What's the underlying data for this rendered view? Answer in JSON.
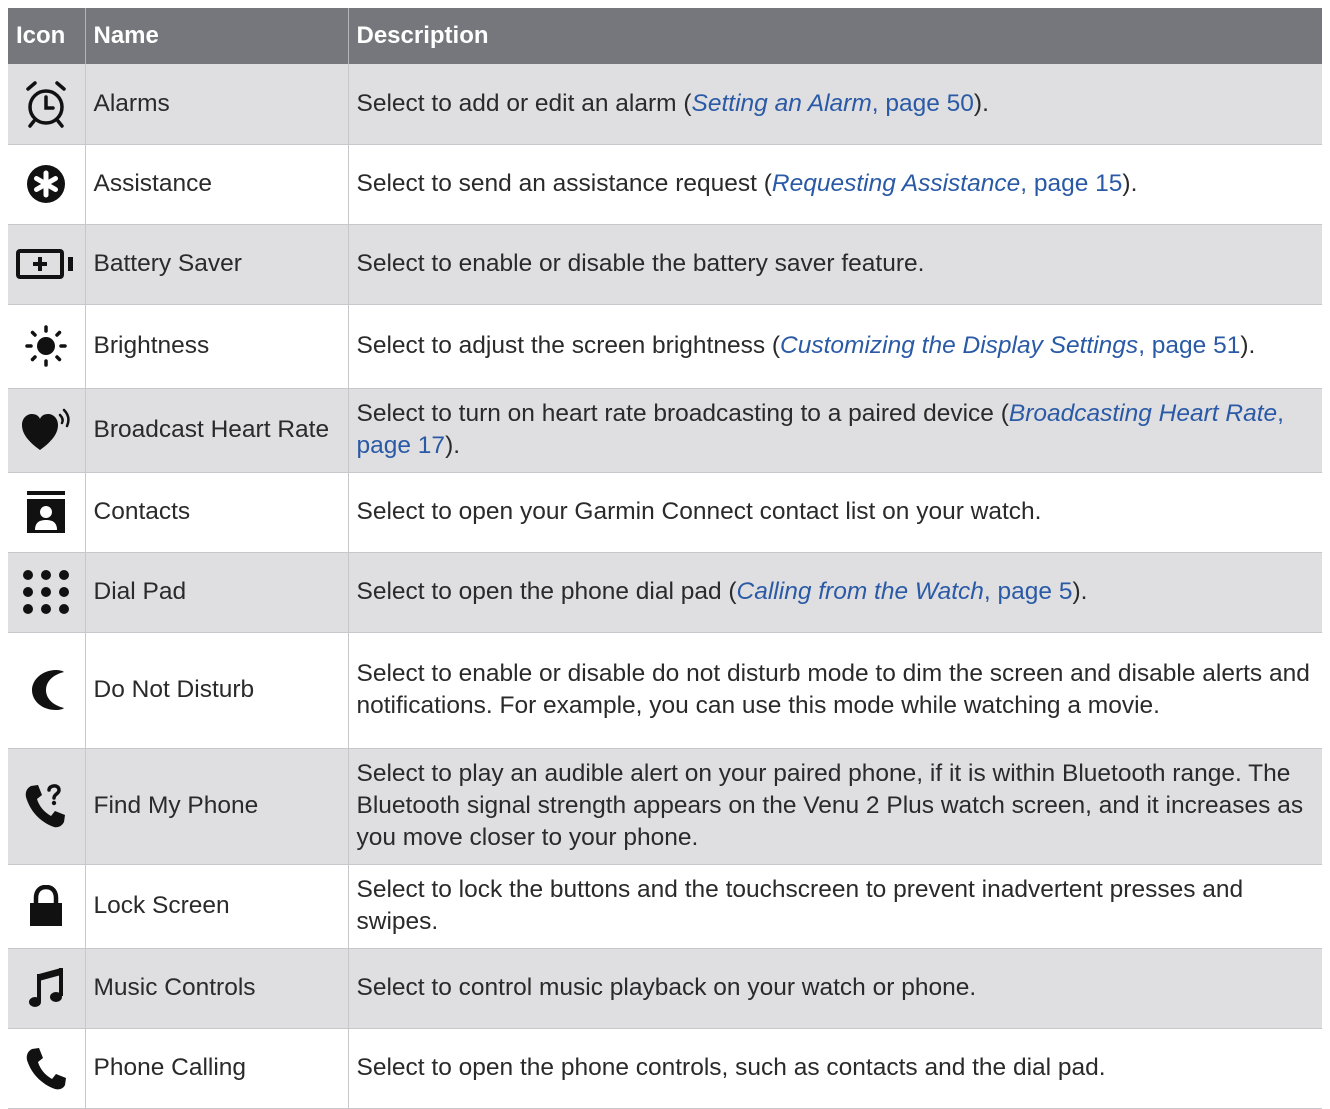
{
  "header": {
    "icon": "Icon",
    "name": "Name",
    "description": "Description"
  },
  "rows": [
    {
      "icon": "alarm-clock-icon",
      "name": "Alarms",
      "desc_pre": "Select to add or edit an alarm (",
      "link_title": "Setting an Alarm",
      "link_page": ", page 50",
      "desc_post": ")."
    },
    {
      "icon": "assistance-icon",
      "name": "Assistance",
      "desc_pre": "Select to send an assistance request (",
      "link_title": "Requesting Assistance",
      "link_page": ", page 15",
      "desc_post": ")."
    },
    {
      "icon": "battery-saver-icon",
      "name": "Battery Saver",
      "desc_pre": "Select to enable or disable the battery saver feature.",
      "link_title": "",
      "link_page": "",
      "desc_post": ""
    },
    {
      "icon": "brightness-icon",
      "name": "Brightness",
      "desc_pre": "Select to adjust the screen brightness (",
      "link_title": "Customizing the Display Settings",
      "link_page": ", page 51",
      "desc_post": ")."
    },
    {
      "icon": "broadcast-heart-icon",
      "name": "Broadcast Heart Rate",
      "desc_pre": "Select to turn on heart rate broadcasting to a paired device (",
      "link_title": "Broadcasting Heart Rate",
      "link_page": ", page 17",
      "desc_post": ")."
    },
    {
      "icon": "contacts-icon",
      "name": "Contacts",
      "desc_pre": "Select to open your Garmin Connect contact list on your watch.",
      "link_title": "",
      "link_page": "",
      "desc_post": ""
    },
    {
      "icon": "dial-pad-icon",
      "name": "Dial Pad",
      "desc_pre": "Select to open the phone dial pad (",
      "link_title": "Calling from the Watch",
      "link_page": ", page 5",
      "desc_post": ")."
    },
    {
      "icon": "moon-icon",
      "name": "Do Not Disturb",
      "desc_pre": "Select to enable or disable do not disturb mode to dim the screen and disable alerts and notifications. For example, you can use this mode while watching a movie.",
      "link_title": "",
      "link_page": "",
      "desc_post": ""
    },
    {
      "icon": "find-phone-icon",
      "name": "Find My Phone",
      "desc_pre": "Select to play an audible alert on your paired phone, if it is within Bluetooth range. The Bluetooth signal strength appears on the Venu 2 Plus watch screen, and it increases as you move closer to your phone.",
      "link_title": "",
      "link_page": "",
      "desc_post": ""
    },
    {
      "icon": "lock-icon",
      "name": "Lock Screen",
      "desc_pre": "Select to lock the buttons and the touchscreen to prevent inadvertent presses and swipes.",
      "link_title": "",
      "link_page": "",
      "desc_post": ""
    },
    {
      "icon": "music-note-icon",
      "name": "Music Controls",
      "desc_pre": "Select to control music playback on your watch or phone.",
      "link_title": "",
      "link_page": "",
      "desc_post": ""
    },
    {
      "icon": "phone-icon",
      "name": "Phone Calling",
      "desc_pre": "Select to open the phone controls, such as contacts and the dial pad.",
      "link_title": "",
      "link_page": "",
      "desc_post": ""
    }
  ]
}
